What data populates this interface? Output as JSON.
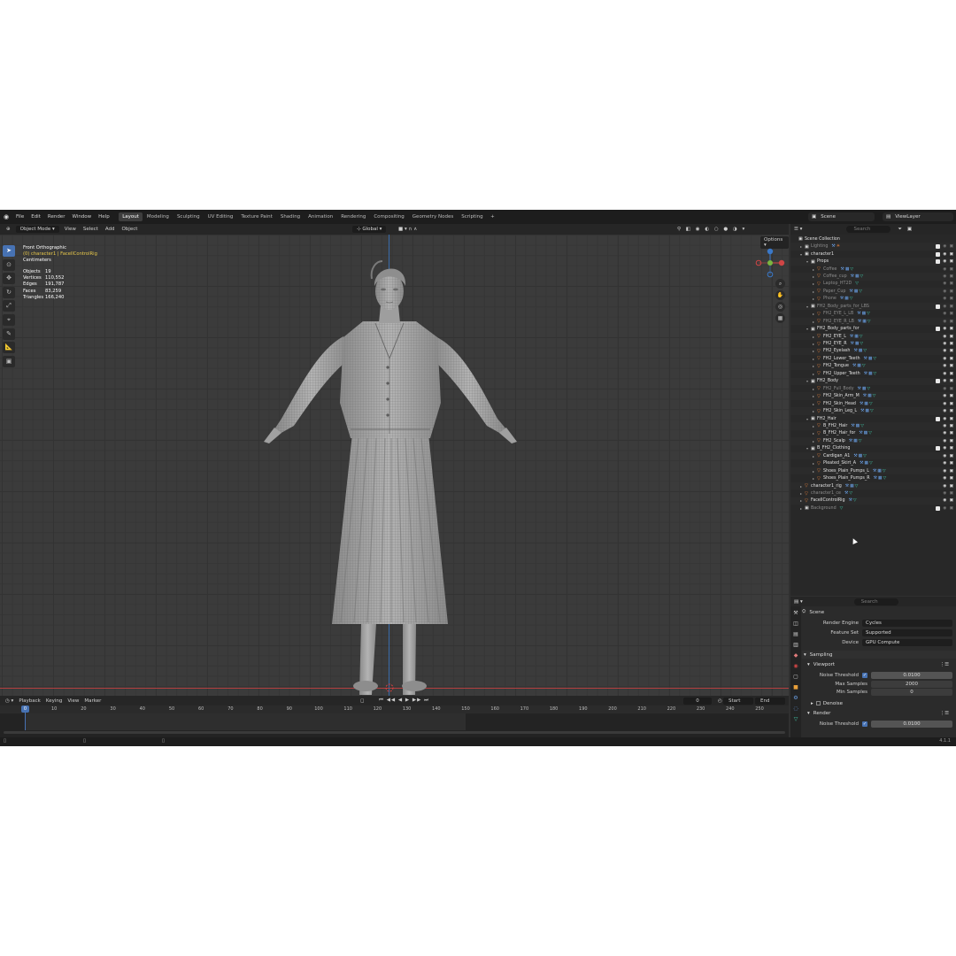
{
  "topbar": {
    "menus": [
      "File",
      "Edit",
      "Render",
      "Window",
      "Help"
    ],
    "workspaces": [
      "Layout",
      "Modeling",
      "Sculpting",
      "UV Editing",
      "Texture Paint",
      "Shading",
      "Animation",
      "Rendering",
      "Compositing",
      "Geometry Nodes",
      "Scripting"
    ],
    "active_workspace": "Layout",
    "add_tab": "+",
    "scene": "Scene",
    "view_layer": "ViewLayer"
  },
  "viewport_header": {
    "mode": "Object Mode",
    "menus": [
      "View",
      "Select",
      "Add",
      "Object"
    ],
    "orientation": "Global",
    "options": "Options"
  },
  "viewport": {
    "view_name": "Front Orthographic",
    "active": "(0) character1 | FacellControlRig",
    "units": "Centimeters",
    "stats": [
      {
        "k": "Objects",
        "v": "19"
      },
      {
        "k": "Vertices",
        "v": "110,552"
      },
      {
        "k": "Edges",
        "v": "191,787"
      },
      {
        "k": "Faces",
        "v": "83,259"
      },
      {
        "k": "Triangles",
        "v": "166,240"
      }
    ]
  },
  "timeline": {
    "menus": [
      "Playback",
      "Keying",
      "View",
      "Marker"
    ],
    "current_frame": "0",
    "start_label": "Start",
    "start": "0",
    "end_label": "End",
    "end": "150",
    "playhead_label": "0",
    "ticks": [
      "10",
      "20",
      "30",
      "40",
      "50",
      "60",
      "70",
      "80",
      "90",
      "100",
      "110",
      "120",
      "130",
      "140",
      "150",
      "160",
      "170",
      "180",
      "190",
      "200",
      "210",
      "220",
      "230",
      "240",
      "250"
    ]
  },
  "outliner": {
    "search_placeholder": "Search",
    "rows": [
      {
        "label": "Scene Collection",
        "depth": 0,
        "type": "coll",
        "arrow": "",
        "dim": false,
        "mods": ""
      },
      {
        "label": "Lighting",
        "depth": 1,
        "type": "coll",
        "arrow": "▸",
        "dim": true,
        "mods": "⚒☀"
      },
      {
        "label": "character1",
        "depth": 1,
        "type": "coll",
        "arrow": "▾",
        "dim": false,
        "mods": ""
      },
      {
        "label": "Props",
        "depth": 2,
        "type": "coll",
        "arrow": "▾",
        "dim": false,
        "mods": ""
      },
      {
        "label": "Coffee",
        "depth": 3,
        "type": "obj",
        "arrow": "▸",
        "dim": true,
        "mods": "⚒▦▽"
      },
      {
        "label": "Coffee_cup",
        "depth": 3,
        "type": "obj",
        "arrow": "▸",
        "dim": true,
        "mods": "⚒▦▽"
      },
      {
        "label": "Laptop_HT2D",
        "depth": 3,
        "type": "obj",
        "arrow": "▸",
        "dim": true,
        "mods": "▽"
      },
      {
        "label": "Paper_Cup",
        "depth": 3,
        "type": "obj",
        "arrow": "▸",
        "dim": true,
        "mods": "⚒▦▽"
      },
      {
        "label": "Phone",
        "depth": 3,
        "type": "obj",
        "arrow": "▸",
        "dim": true,
        "mods": "⚒▦▽"
      },
      {
        "label": "FH2_Body_parts_for_LBS",
        "depth": 2,
        "type": "coll",
        "arrow": "▾",
        "dim": true,
        "mods": ""
      },
      {
        "label": "FH2_EYE_L_LB",
        "depth": 3,
        "type": "obj",
        "arrow": "▸",
        "dim": true,
        "mods": "⚒▦▽"
      },
      {
        "label": "FH2_EYE_R_LB",
        "depth": 3,
        "type": "obj",
        "arrow": "▸",
        "dim": true,
        "mods": "⚒▦▽"
      },
      {
        "label": "FH2_Body_parts_for",
        "depth": 2,
        "type": "coll",
        "arrow": "▾",
        "dim": false,
        "mods": ""
      },
      {
        "label": "FH2_EYE_L",
        "depth": 3,
        "type": "obj",
        "arrow": "▸",
        "dim": false,
        "mods": "⚒▦▽"
      },
      {
        "label": "FH2_EYE_R",
        "depth": 3,
        "type": "obj",
        "arrow": "▸",
        "dim": false,
        "mods": "⚒▦▽"
      },
      {
        "label": "FH2_Eyelash",
        "depth": 3,
        "type": "obj",
        "arrow": "▸",
        "dim": false,
        "mods": "⚒▦▽"
      },
      {
        "label": "FH2_Lower_Teeth",
        "depth": 3,
        "type": "obj",
        "arrow": "▸",
        "dim": false,
        "mods": "⚒▦▽"
      },
      {
        "label": "FH2_Tongue",
        "depth": 3,
        "type": "obj",
        "arrow": "▸",
        "dim": false,
        "mods": "⚒▦▽"
      },
      {
        "label": "FH2_Upper_Teeth",
        "depth": 3,
        "type": "obj",
        "arrow": "▸",
        "dim": false,
        "mods": "⚒▦▽"
      },
      {
        "label": "FH2_Body",
        "depth": 2,
        "type": "coll",
        "arrow": "▾",
        "dim": false,
        "mods": ""
      },
      {
        "label": "FH2_Full_Body",
        "depth": 3,
        "type": "obj",
        "arrow": "▸",
        "dim": true,
        "mods": "⚒▦▽"
      },
      {
        "label": "FH2_Skin_Arm_M",
        "depth": 3,
        "type": "obj",
        "arrow": "▸",
        "dim": false,
        "mods": "⚒▦▽"
      },
      {
        "label": "FH2_Skin_Head",
        "depth": 3,
        "type": "obj",
        "arrow": "▸",
        "dim": false,
        "mods": "⚒▦▽"
      },
      {
        "label": "FH2_Skin_Leg_L",
        "depth": 3,
        "type": "obj",
        "arrow": "▸",
        "dim": false,
        "mods": "⚒▦▽"
      },
      {
        "label": "FH2_Hair",
        "depth": 2,
        "type": "coll",
        "arrow": "▾",
        "dim": false,
        "mods": ""
      },
      {
        "label": "B_FH2_Hair",
        "depth": 3,
        "type": "obj",
        "arrow": "▸",
        "dim": false,
        "mods": "⚒▦▽"
      },
      {
        "label": "B_FH2_Hair_for",
        "depth": 3,
        "type": "obj",
        "arrow": "▸",
        "dim": false,
        "mods": "⚒▦▽"
      },
      {
        "label": "FH2_Scalp",
        "depth": 3,
        "type": "obj",
        "arrow": "▸",
        "dim": false,
        "mods": "⚒▦▽"
      },
      {
        "label": "B_FH2_Clothing",
        "depth": 2,
        "type": "coll",
        "arrow": "▾",
        "dim": false,
        "mods": ""
      },
      {
        "label": "Cardigan_A1",
        "depth": 3,
        "type": "obj",
        "arrow": "▸",
        "dim": false,
        "mods": "⚒▦▽"
      },
      {
        "label": "Pleated_Skirt_A",
        "depth": 3,
        "type": "obj",
        "arrow": "▸",
        "dim": false,
        "mods": "⚒▦▽"
      },
      {
        "label": "Shoes_Plain_Pumps_L",
        "depth": 3,
        "type": "obj",
        "arrow": "▸",
        "dim": false,
        "mods": "⚒▦▽"
      },
      {
        "label": "Shoes_Plain_Pumps_R",
        "depth": 3,
        "type": "obj",
        "arrow": "▸",
        "dim": false,
        "mods": "⚒▦▽"
      },
      {
        "label": "character1_rig",
        "depth": 1,
        "type": "obj",
        "arrow": "▸",
        "dim": false,
        "mods": "⚒▦▽"
      },
      {
        "label": "character1_ce",
        "depth": 1,
        "type": "obj",
        "arrow": "▸",
        "dim": true,
        "mods": "⚒▽"
      },
      {
        "label": "FacellControlRig",
        "depth": 1,
        "type": "obj",
        "arrow": "▸",
        "dim": false,
        "mods": "⚒▽"
      },
      {
        "label": "Background",
        "depth": 1,
        "type": "coll",
        "arrow": "▸",
        "dim": true,
        "mods": "▽"
      }
    ]
  },
  "properties": {
    "search_placeholder": "Search",
    "context": "Scene",
    "render_engine_label": "Render Engine",
    "render_engine": "Cycles",
    "feature_set_label": "Feature Set",
    "feature_set": "Supported",
    "device_label": "Device",
    "device": "GPU Compute",
    "sampling": "Sampling",
    "viewport": "Viewport",
    "noise_threshold_label": "Noise Threshold",
    "noise_threshold": "0.0100",
    "max_samples_label": "Max Samples",
    "max_samples": "2000",
    "min_samples_label": "Min Samples",
    "min_samples": "0",
    "denoise": "Denoise",
    "render": "Render",
    "render_noise_threshold": "0.0100"
  },
  "status": {
    "version": "4.1.1"
  },
  "colors": {
    "accent": "#4772b3",
    "object_orange": "#e9803a",
    "modifier_blue": "#6aa0e6",
    "mesh_green": "#3fc8a8"
  }
}
